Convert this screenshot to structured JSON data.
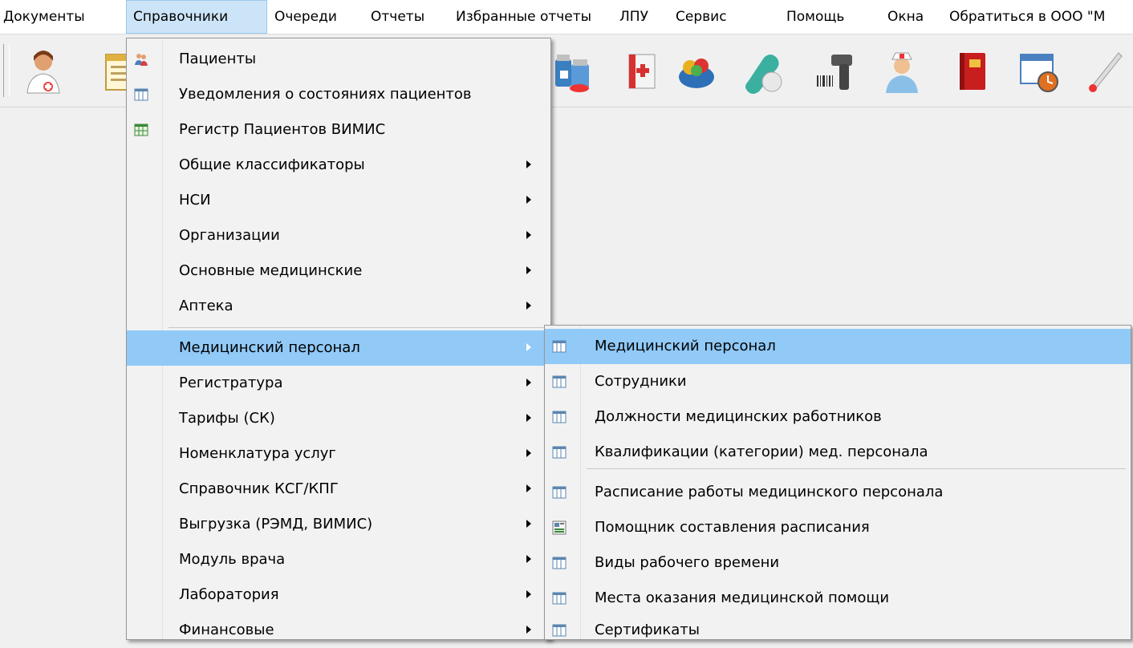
{
  "menubar": {
    "items": [
      {
        "label": "Документы"
      },
      {
        "label": "Справочники"
      },
      {
        "label": "Очереди"
      },
      {
        "label": "Отчеты"
      },
      {
        "label": "Избранные отчеты"
      },
      {
        "label": "ЛПУ"
      },
      {
        "label": "Сервис"
      },
      {
        "label": "Помощь"
      },
      {
        "label": "Окна"
      },
      {
        "label": "Обратиться в ООО \"М"
      }
    ],
    "active_index": 1
  },
  "toolbar": {
    "icons": [
      "doctor-icon",
      "document-icon",
      "medicines-icon",
      "medical-book-icon",
      "vaccine-basket-icon",
      "pill-icon",
      "barcode-scanner-icon",
      "nurse-icon",
      "red-book-icon",
      "schedule-clock-icon",
      "thermometer-icon"
    ]
  },
  "menu": {
    "items": [
      {
        "label": "Пациенты",
        "icon": "patients-icon"
      },
      {
        "label": "Уведомления о состояниях пациентов",
        "icon": "table-icon"
      },
      {
        "label": "Регистр Пациентов ВИМИС",
        "icon": "green-table-icon"
      },
      {
        "label": "Общие классификаторы",
        "submenu": true
      },
      {
        "label": "НСИ",
        "submenu": true
      },
      {
        "label": "Организации",
        "submenu": true
      },
      {
        "label": "Основные медицинские",
        "submenu": true
      },
      {
        "label": "Аптека",
        "submenu": true
      },
      {
        "label": "Медицинский персонал",
        "submenu": true,
        "highlighted": true
      },
      {
        "label": "Регистратура",
        "submenu": true
      },
      {
        "label": "Тарифы (СК)",
        "submenu": true
      },
      {
        "label": "Номенклатура услуг",
        "submenu": true
      },
      {
        "label": "Справочник КСГ/КПГ",
        "submenu": true
      },
      {
        "label": "Выгрузка (РЭМД, ВИМИС)",
        "submenu": true
      },
      {
        "label": "Модуль врача",
        "submenu": true
      },
      {
        "label": "Лаборатория",
        "submenu": true
      },
      {
        "label": "Финансовые",
        "submenu": true
      }
    ]
  },
  "submenu": {
    "items": [
      {
        "label": "Медицинский персонал",
        "icon": "table-icon",
        "highlighted": true
      },
      {
        "label": "Сотрудники",
        "icon": "table-icon"
      },
      {
        "label": "Должности медицинских работников",
        "icon": "table-icon"
      },
      {
        "label": "Квалификации (категории) мед. персонала",
        "icon": "table-icon"
      },
      {
        "label": "Расписание работы медицинского персонала",
        "icon": "table-icon"
      },
      {
        "label": "Помощник составления расписания",
        "icon": "schedule-wizard-icon"
      },
      {
        "label": "Виды рабочего времени",
        "icon": "table-icon"
      },
      {
        "label": "Места оказания медицинской помощи",
        "icon": "table-icon"
      },
      {
        "label": "Сертификаты",
        "icon": "table-icon"
      }
    ]
  },
  "colors": {
    "menu_highlight": "#91c9f7",
    "menubar_active": "#cce4f7",
    "menu_background": "#f2f2f2"
  }
}
